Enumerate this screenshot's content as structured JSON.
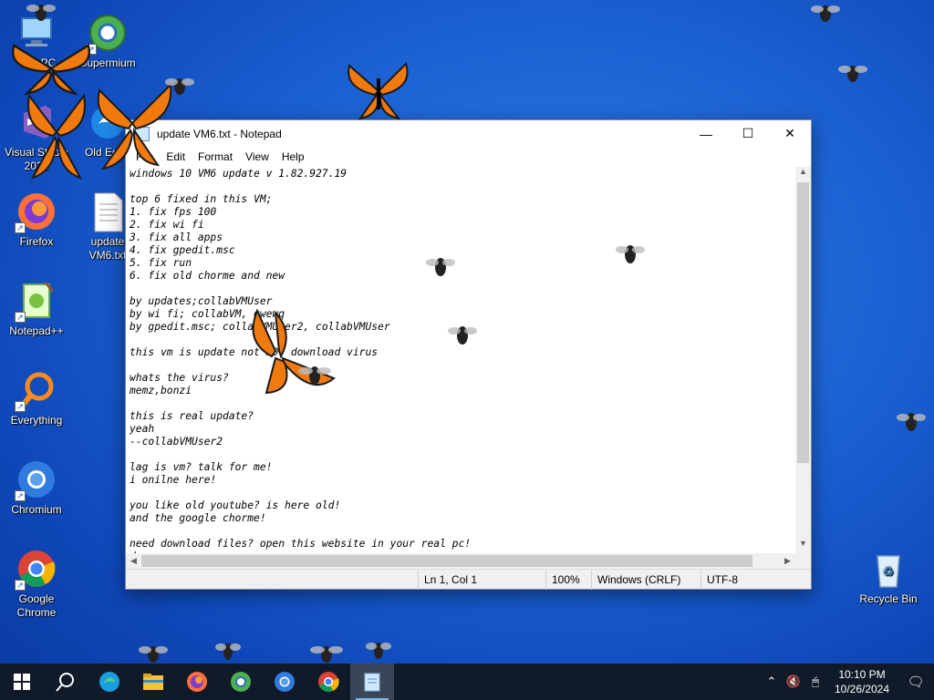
{
  "desktop": {
    "icons": [
      {
        "label": "This PC",
        "icon": "computer-icon"
      },
      {
        "label": "Supermium",
        "icon": "supermium-icon"
      },
      {
        "label": "Visual Studio 2022",
        "icon": "visual-studio-icon"
      },
      {
        "label": "Old Edge",
        "icon": "edge-icon"
      },
      {
        "label": "Firefox",
        "icon": "firefox-icon"
      },
      {
        "label": "update VM6.txt",
        "icon": "text-file-icon"
      },
      {
        "label": "Notepad++",
        "icon": "notepadpp-icon"
      },
      {
        "label": "Everything",
        "icon": "search-icon"
      },
      {
        "label": "Chromium",
        "icon": "chromium-icon"
      },
      {
        "label": "Google Chrome",
        "icon": "chrome-icon"
      },
      {
        "label": "Recycle Bin",
        "icon": "recycle-bin-icon"
      }
    ]
  },
  "notepad": {
    "title": "update VM6.txt - Notepad",
    "menu": [
      "File",
      "Edit",
      "Format",
      "View",
      "Help"
    ],
    "content": "windows 10 VM6 update v 1.82.927.19\n\ntop 6 fixed in this VM;\n1. fix fps 100\n2. fix wi fi\n3. fix all apps\n4. fix gpedit.msc\n5. fix run\n6. fix old chorme and new\n\nby updates;collabVMUser\nby wi fi; collabVM, qwewq\nby gpedit.msc; collabVMUser2, collabVMUser\n\nthis vm is update not NOT download virus\n\nwhats the virus?\nmemz,bonzi\n\nthis is real update?\nyeah\n--collabVMUser2\n\nlag is vm? talk for me!\ni onilne here!\n\nyou like old youtube? is here old!\nand the google chorme!\n\nneed download files? open this website in your real pc!\ndsa.sa",
    "status": {
      "position": "Ln 1, Col 1",
      "zoom": "100%",
      "line_ending": "Windows (CRLF)",
      "encoding": "UTF-8"
    }
  },
  "taskbar": {
    "apps": [
      "windows-start-icon",
      "search-icon",
      "edge-icon",
      "file-explorer-icon",
      "firefox-icon",
      "supermium-icon",
      "chromium-icon",
      "chrome-icon",
      "notepad-icon"
    ],
    "time": "10:10 PM",
    "date": "10/26/2024"
  },
  "colors": {
    "desktop_bg": "#1a5fd0",
    "taskbar_bg": "#101a28",
    "accent": "#76b9ed",
    "butterfly": "#f07a10"
  }
}
